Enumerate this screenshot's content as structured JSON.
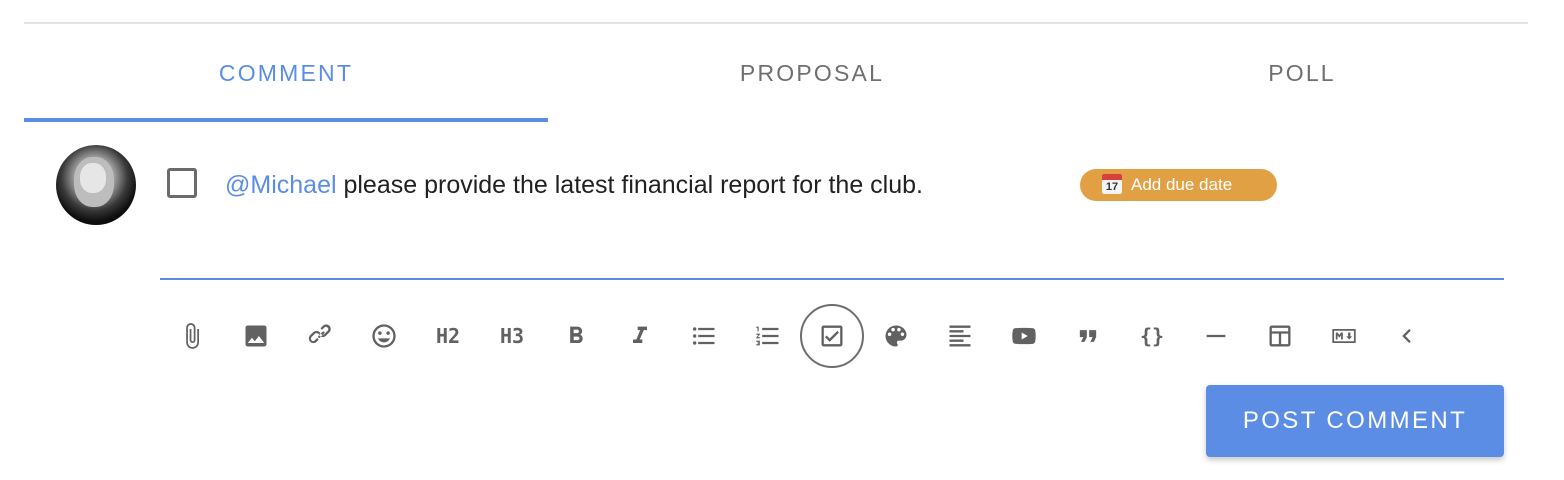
{
  "tabs": [
    {
      "label": "COMMENT",
      "active": true
    },
    {
      "label": "PROPOSAL",
      "active": false
    },
    {
      "label": "POLL",
      "active": false
    }
  ],
  "editor": {
    "task_checked": false,
    "mention": "@Michael",
    "text": " please provide the latest financial report for the club.",
    "due_chip": {
      "label": "Add due date",
      "calendar_day": "17"
    }
  },
  "toolbar": {
    "buttons": [
      {
        "name": "attach-icon"
      },
      {
        "name": "image-icon"
      },
      {
        "name": "link-icon"
      },
      {
        "name": "emoji-icon"
      },
      {
        "name": "heading-2",
        "text": "H2"
      },
      {
        "name": "heading-3",
        "text": "H3"
      },
      {
        "name": "bold-icon"
      },
      {
        "name": "italic-icon"
      },
      {
        "name": "bullet-list-icon"
      },
      {
        "name": "numbered-list-icon"
      },
      {
        "name": "task-list-icon",
        "selected": true
      },
      {
        "name": "palette-icon"
      },
      {
        "name": "align-icon"
      },
      {
        "name": "video-icon"
      },
      {
        "name": "quote-icon"
      },
      {
        "name": "code-block",
        "text": "{}"
      },
      {
        "name": "horizontal-rule-icon"
      },
      {
        "name": "table-icon"
      },
      {
        "name": "markdown-icon"
      },
      {
        "name": "collapse-icon"
      }
    ]
  },
  "actions": {
    "post_label": "POST COMMENT"
  },
  "colors": {
    "accent": "#5a8de3",
    "due_chip": "#e2a044",
    "icon": "#616161"
  }
}
